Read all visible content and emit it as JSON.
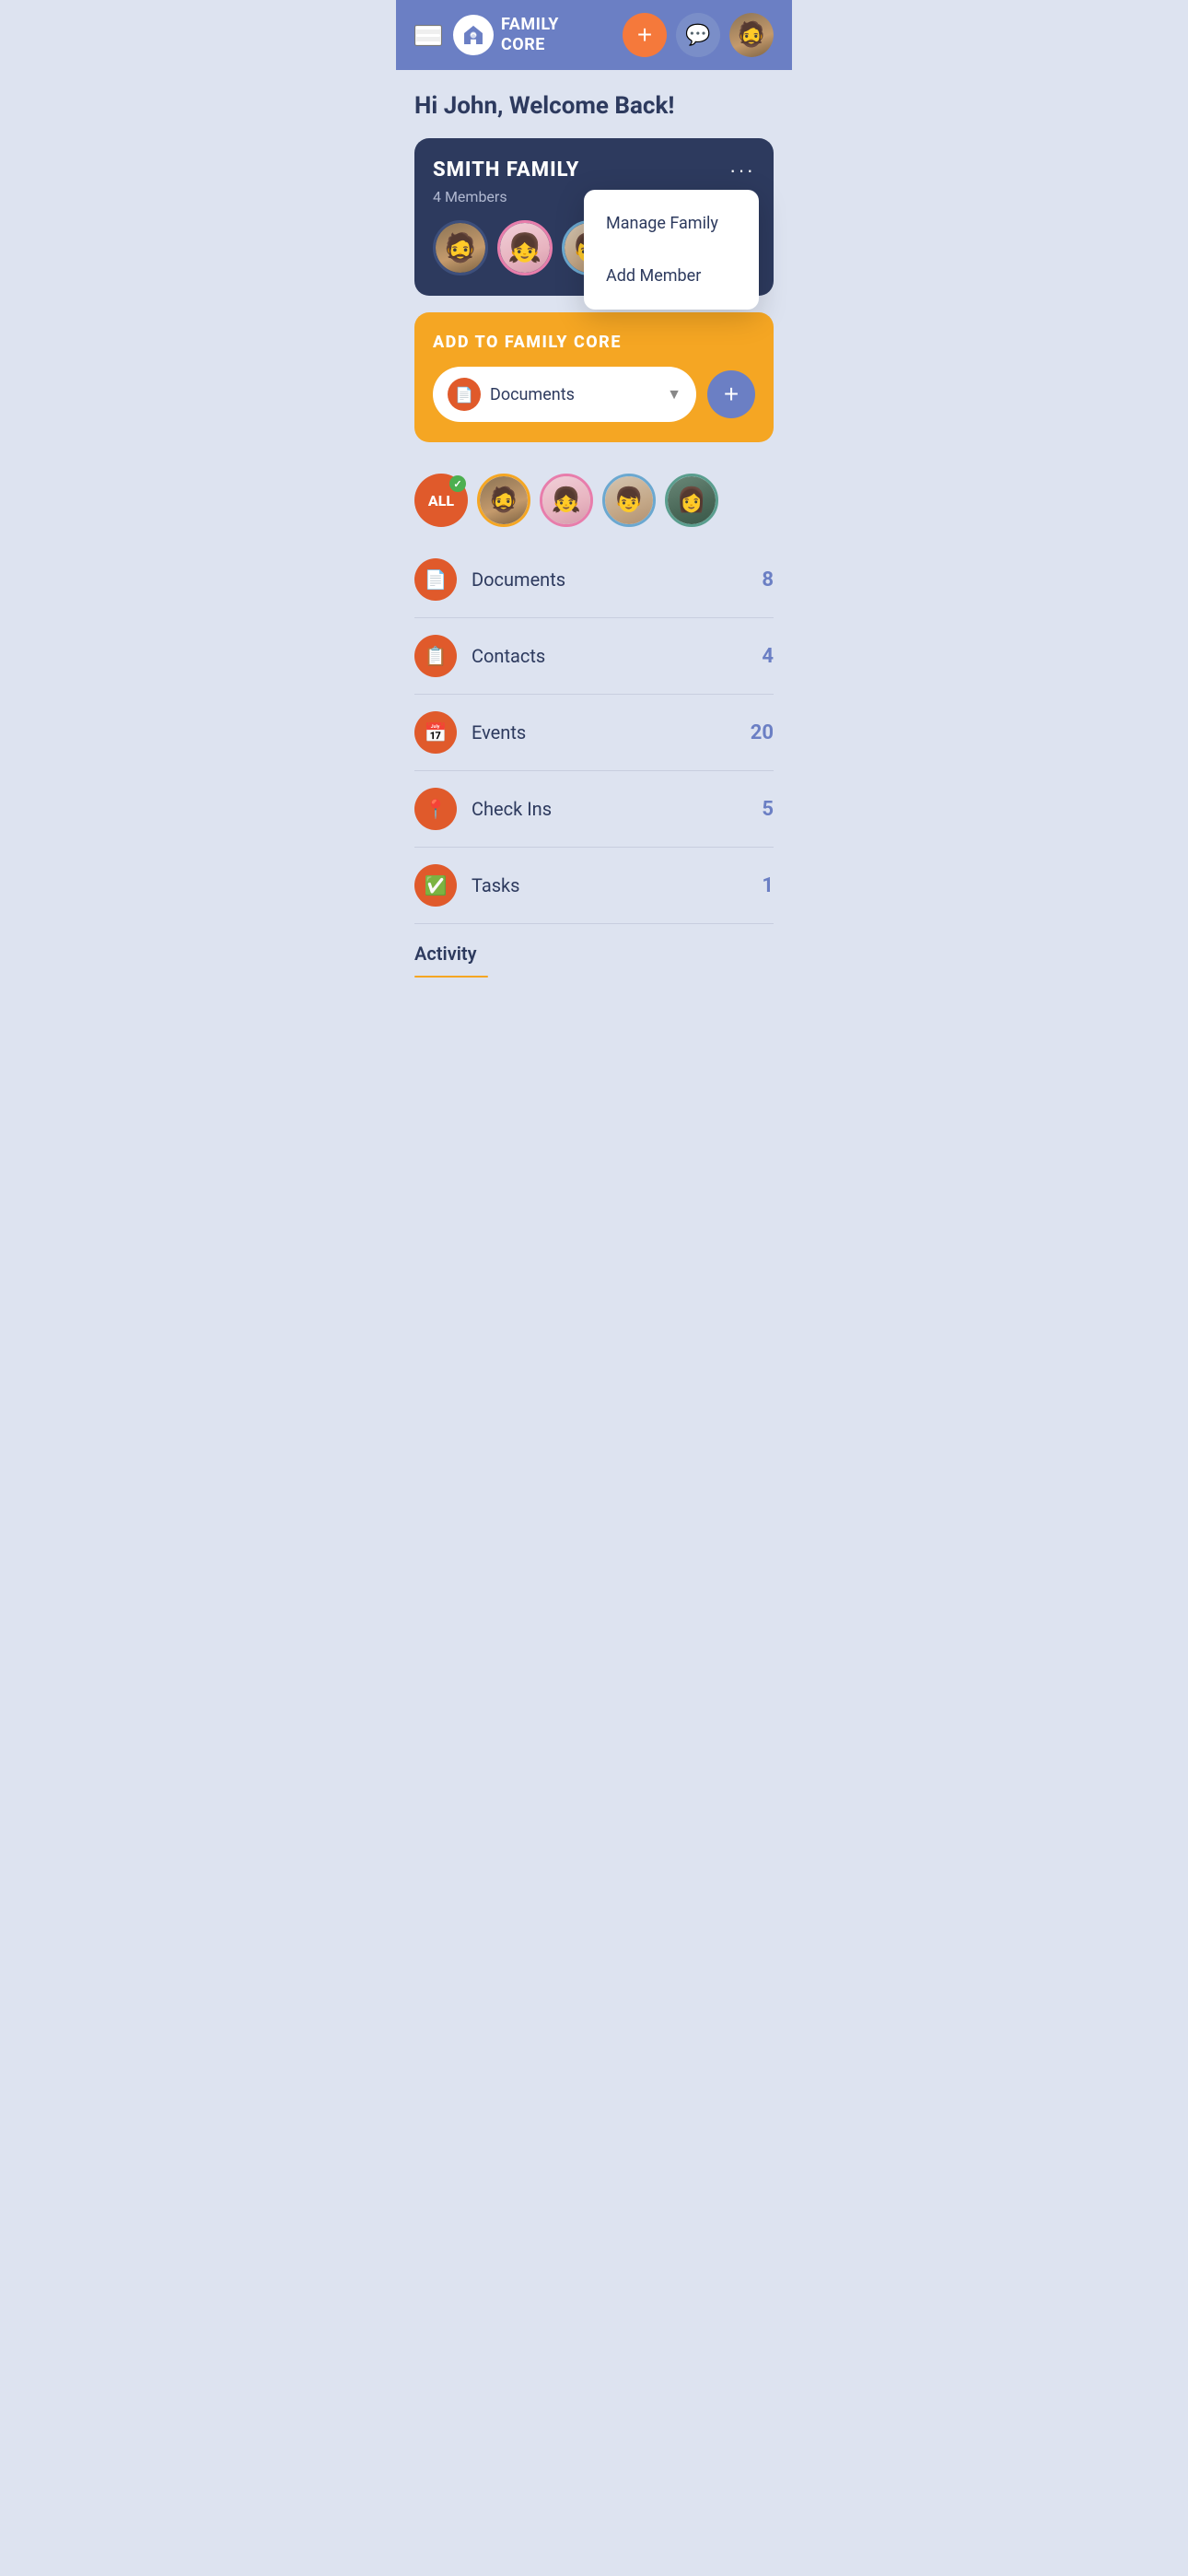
{
  "header": {
    "logo_text_top": "FAMILY",
    "logo_text_bottom": "CORE",
    "add_button_label": "+",
    "chat_icon": "💬",
    "user_avatar_icon": "👤"
  },
  "welcome": {
    "text": "Hi John, Welcome Back!"
  },
  "family_card": {
    "name": "SMITH FAMILY",
    "members_count": "4 Members",
    "more_icon": "···",
    "members": [
      {
        "id": 1,
        "label": "Man avatar",
        "color": "face-man"
      },
      {
        "id": 2,
        "label": "Girl avatar",
        "color": "face-girl"
      },
      {
        "id": 3,
        "label": "Boy avatar",
        "color": "face-boy"
      },
      {
        "id": 4,
        "label": "Woman avatar",
        "color": "face-woman"
      }
    ]
  },
  "dropdown": {
    "items": [
      {
        "label": "Manage Family",
        "id": "manage-family"
      },
      {
        "label": "Add Member",
        "id": "add-member"
      }
    ]
  },
  "add_to_family": {
    "title": "ADD TO FAMILY CORE",
    "select_label": "Documents",
    "select_icon": "📄",
    "add_button_label": "+"
  },
  "filter": {
    "all_label": "ALL",
    "check_icon": "✓",
    "avatars": [
      {
        "id": 1,
        "border": "filter-border-orange",
        "color": "face-man"
      },
      {
        "id": 2,
        "border": "filter-border-pink",
        "color": "face-girl"
      },
      {
        "id": 3,
        "border": "filter-border-blue",
        "color": "face-boy"
      },
      {
        "id": 4,
        "border": "filter-border-teal",
        "color": "face-woman"
      }
    ]
  },
  "categories": [
    {
      "id": "documents",
      "label": "Documents",
      "count": "8",
      "icon": "📄"
    },
    {
      "id": "contacts",
      "label": "Contacts",
      "count": "4",
      "icon": "📋"
    },
    {
      "id": "events",
      "label": "Events",
      "count": "20",
      "icon": "📅"
    },
    {
      "id": "checkins",
      "label": "Check Ins",
      "count": "5",
      "icon": "📍"
    },
    {
      "id": "tasks",
      "label": "Tasks",
      "count": "1",
      "icon": "✅"
    }
  ],
  "activity": {
    "title": "Activity"
  }
}
